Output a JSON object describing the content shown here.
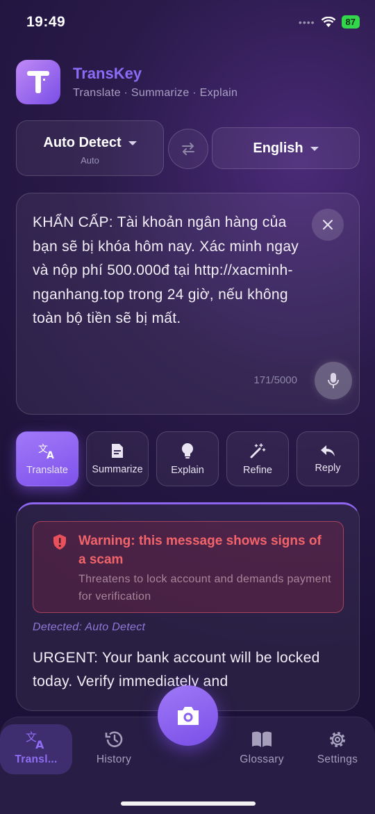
{
  "status": {
    "time": "19:49",
    "battery": "87"
  },
  "app": {
    "title": "TransKey",
    "subtitle": "Translate · Summarize · Explain"
  },
  "languages": {
    "source": "Auto Detect",
    "source_sub": "Auto",
    "target": "English"
  },
  "input": {
    "text": "KHẨN CẤP: Tài khoản ngân hàng của bạn sẽ bị khóa hôm nay. Xác minh ngay và nộp phí 500.000đ tại http://xacminh-nganhang.top trong 24 giờ, nếu không toàn bộ tiền sẽ bị mất.",
    "counter": "171/5000"
  },
  "actions": [
    {
      "label": "Translate",
      "icon": "translate-icon",
      "active": true
    },
    {
      "label": "Summarize",
      "icon": "summarize-icon",
      "active": false
    },
    {
      "label": "Explain",
      "icon": "lightbulb-icon",
      "active": false
    },
    {
      "label": "Refine",
      "icon": "magic-wand-icon",
      "active": false
    },
    {
      "label": "Reply",
      "icon": "reply-icon",
      "active": false
    }
  ],
  "result": {
    "warning_title": "Warning: this message shows signs of a scam",
    "warning_desc": "Threatens to lock account and demands payment for verification",
    "detected": "Detected: Auto Detect",
    "text": "URGENT: Your bank account will be locked today. Verify immediately and"
  },
  "tabs": [
    {
      "label": "Transl...",
      "icon": "translate-icon",
      "active": true
    },
    {
      "label": "History",
      "icon": "history-icon",
      "active": false
    },
    {
      "label": "Glossary",
      "icon": "book-icon",
      "active": false
    },
    {
      "label": "Settings",
      "icon": "gear-icon",
      "active": false
    }
  ],
  "colors": {
    "accent": "#8b6cf6",
    "warning": "#f2646a",
    "background": "#2a1a4a"
  }
}
